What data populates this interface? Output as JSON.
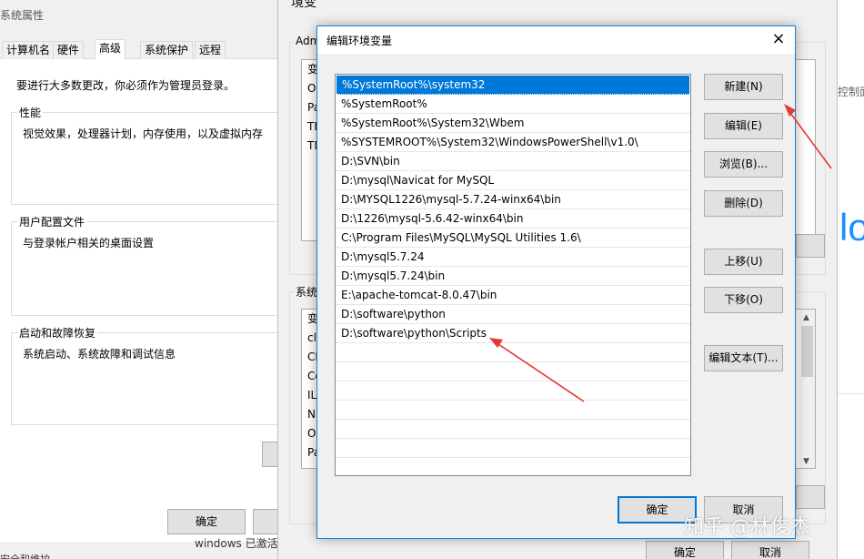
{
  "system_properties": {
    "title": "系统属性",
    "tabs": [
      "计算机名",
      "硬件",
      "高级",
      "系统保护",
      "远程"
    ],
    "active_tab": "高级",
    "admin_note": "要进行大多数更改，你必须作为管理员登录。",
    "groups": [
      {
        "label": "性能",
        "text": "视觉效果，处理器计划，内存使用，以及虚拟内存"
      },
      {
        "label": "用户配置文件",
        "text": "与登录帐户相关的桌面设置"
      },
      {
        "label": "启动和故障恢复",
        "text": "系统启动、系统故障和调试信息"
      }
    ],
    "ok_label": "确定",
    "footer_fragment": "安全和维护"
  },
  "env_vars": {
    "title_fragment": "境变",
    "user_group_label": "Adm",
    "user_rows": [
      "变",
      "O",
      "Pa",
      "TE",
      "TM"
    ],
    "system_group_label": "系统",
    "system_rows": [
      "变",
      "cl",
      "Cl",
      "Co",
      "IL",
      "N",
      "O",
      "Pa"
    ],
    "ok_label": "确定",
    "cancel_label": "取消",
    "windows_fragment": "windows 已激活",
    "right_fragment_label": "控制面",
    "right_fragment_big": "lo"
  },
  "edit_dialog": {
    "title": "编辑环境变量",
    "close_icon": "×",
    "paths": [
      "%SystemRoot%\\system32",
      "%SystemRoot%",
      "%SystemRoot%\\System32\\Wbem",
      "%SYSTEMROOT%\\System32\\WindowsPowerShell\\v1.0\\",
      "D:\\SVN\\bin",
      "D:\\mysql\\Navicat for MySQL",
      "D:\\MYSQL1226\\mysql-5.7.24-winx64\\bin",
      "D:\\1226\\mysql-5.6.42-winx64\\bin",
      "C:\\Program Files\\MySQL\\MySQL Utilities 1.6\\",
      "D:\\mysql5.7.24",
      "D:\\mysql5.7.24\\bin",
      "E:\\apache-tomcat-8.0.47\\bin",
      "D:\\software\\python",
      "D:\\software\\python\\Scripts",
      "",
      "",
      "",
      "",
      "",
      "",
      ""
    ],
    "selected_index": 0,
    "buttons": {
      "new": "新建(N)",
      "edit": "编辑(E)",
      "browse": "浏览(B)...",
      "delete": "删除(D)",
      "move_up": "上移(U)",
      "move_down": "下移(O)",
      "edit_text": "编辑文本(T)..."
    },
    "ok_label": "确定",
    "cancel_label": "取消"
  },
  "annotation_color": "#e53935",
  "accent_color": "#0078d7",
  "watermark": "知乎 @林俊杰"
}
